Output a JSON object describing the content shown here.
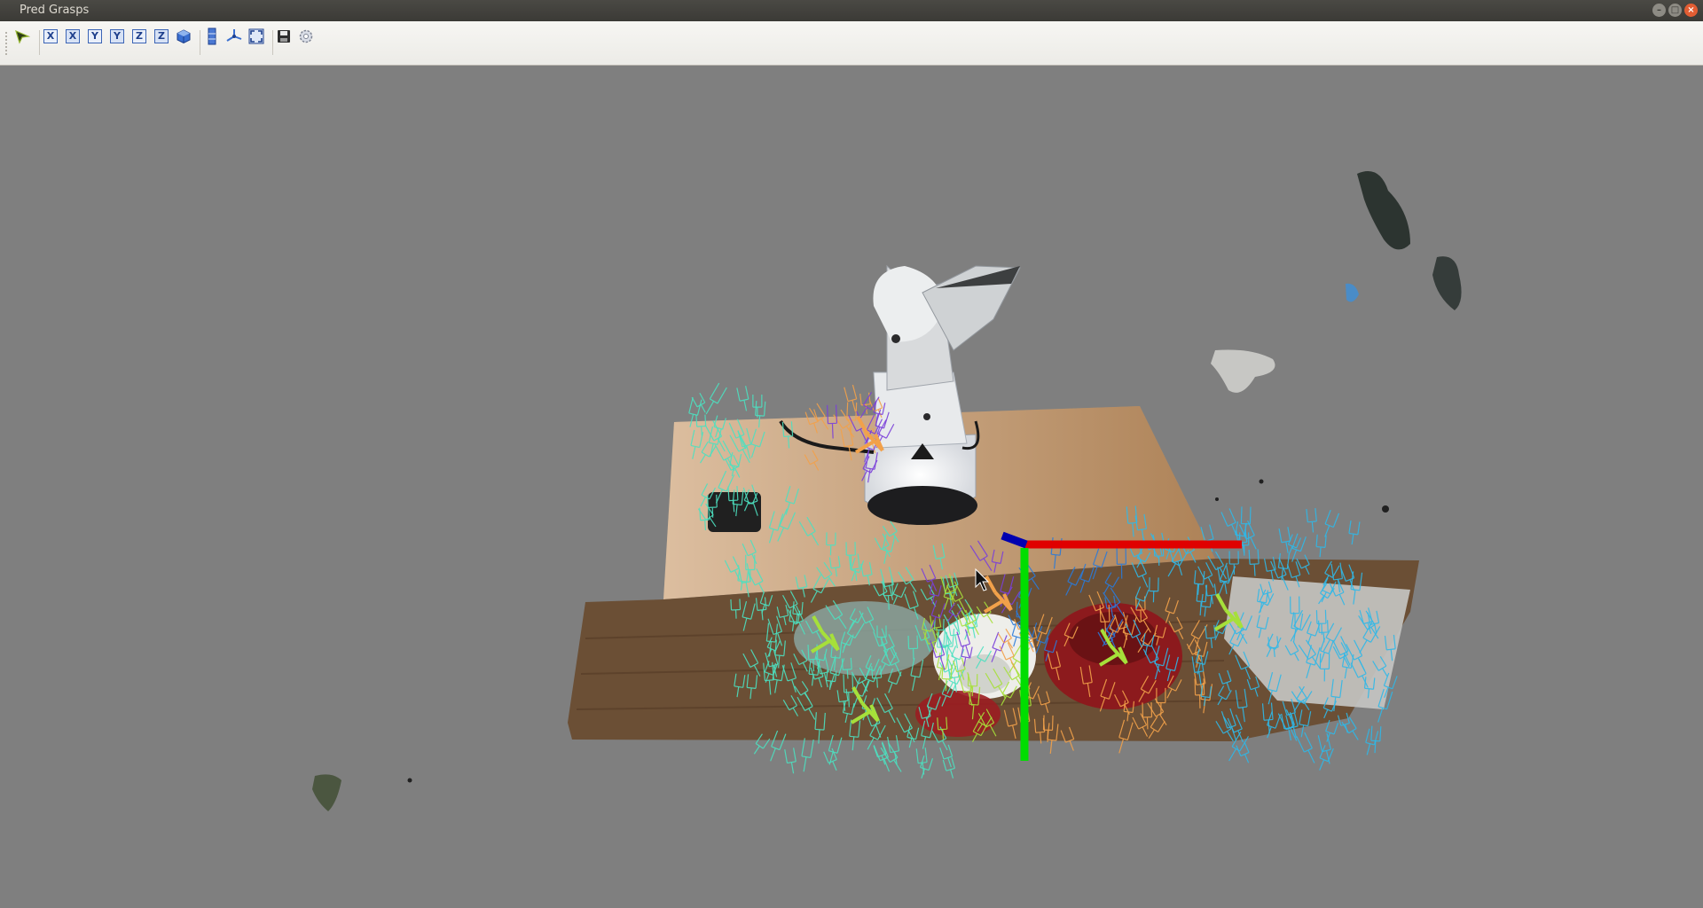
{
  "window": {
    "title": "Pred Grasps",
    "controls": {
      "minimize_icon": "minimize-icon",
      "maximize_icon": "maximize-icon",
      "close_icon": "close-icon"
    }
  },
  "toolbar": {
    "tools": [
      {
        "name": "interact-tool",
        "icon": "interact-icon"
      },
      {
        "name": "view-x-positive",
        "glyph": "X"
      },
      {
        "name": "view-x-negative",
        "glyph": "X"
      },
      {
        "name": "view-y-positive",
        "glyph": "Y"
      },
      {
        "name": "view-y-negative",
        "glyph": "Y"
      },
      {
        "name": "view-z-positive",
        "glyph": "Z"
      },
      {
        "name": "view-z-negative",
        "glyph": "Z"
      },
      {
        "name": "view-isometric",
        "icon": "cube-icon"
      },
      {
        "name": "parallel-projection",
        "icon": "projection-icon"
      },
      {
        "name": "reset-camera",
        "icon": "axes-icon"
      },
      {
        "name": "fit-view",
        "icon": "fullscreen-icon"
      },
      {
        "name": "save-screenshot",
        "icon": "save-icon"
      },
      {
        "name": "settings",
        "icon": "gear-icon"
      }
    ]
  },
  "scene": {
    "background_color": "#7f7f7f",
    "axis_colors": {
      "x": "#e00000",
      "y": "#00dd00",
      "z": "#0000b0"
    },
    "grasp_colors": [
      "#4de0c0",
      "#2fb8e8",
      "#f2a14a",
      "#7a3fd9",
      "#a6e03a",
      "#2a7ad9"
    ]
  }
}
